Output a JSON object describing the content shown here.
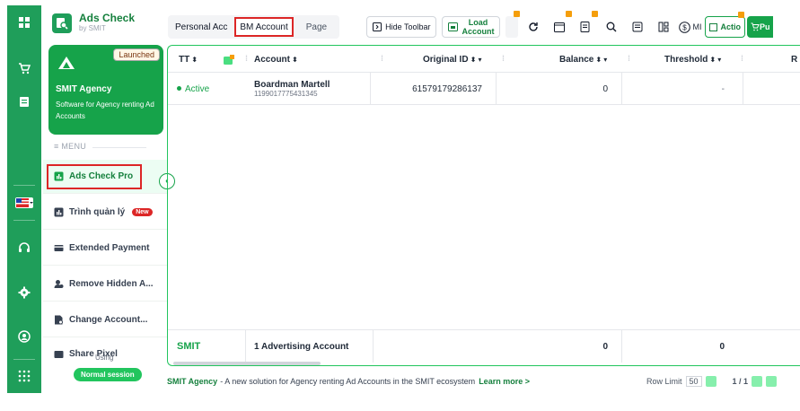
{
  "brand": {
    "title": "Ads Check",
    "subtitle": "by SMIT"
  },
  "agency_card": {
    "badge": "Launched",
    "name": "SMIT Agency",
    "description": "Software for Agency renting Ad Accounts"
  },
  "menu": {
    "label": "≡ MENU",
    "items": [
      {
        "label": "Ads Check Pro",
        "active": true
      },
      {
        "label": "Trình quản lý",
        "badge": "New"
      },
      {
        "label": "Extended Payment"
      },
      {
        "label": "Remove Hidden A..."
      },
      {
        "label": "Change Account..."
      },
      {
        "label": "Share Pixel"
      }
    ]
  },
  "session": {
    "using": "Using",
    "label": "Normal session"
  },
  "toolbar": {
    "tabs": [
      "Personal Acc",
      "BM Account",
      "Page"
    ],
    "selected_tab": "BM Account",
    "hide_toolbar": "Hide Toolbar",
    "load_account_line1": "Load",
    "load_account_line2": "Account",
    "mi_label": "MI",
    "action_label": "Actio",
    "publish_label": "Pu"
  },
  "table": {
    "columns": [
      "TT",
      "Account",
      "Original ID",
      "Balance",
      "Threshold",
      "R"
    ],
    "rows": [
      {
        "status": "Active",
        "account_name": "Boardman Martell",
        "account_id": "1199017775431345",
        "original_id": "61579179286137",
        "balance": "0",
        "threshold": "-"
      }
    ],
    "footer": {
      "logo": "SMIT",
      "summary": "1 Advertising Account",
      "balance_total": "0",
      "threshold_total": "0"
    }
  },
  "footer": {
    "brand": "SMIT Agency",
    "message": "- A new solution for Agency renting Ad Accounts in the SMIT ecosystem",
    "learn_more": "Learn more >",
    "row_limit_label": "Row Limit",
    "row_limit_value": "50",
    "page_info": "1 / 1"
  },
  "colors": {
    "primary_green": "#1f9e5a",
    "accent_green": "#16a34a",
    "highlight_red": "#dc2626",
    "lock_amber": "#f59e0b"
  }
}
